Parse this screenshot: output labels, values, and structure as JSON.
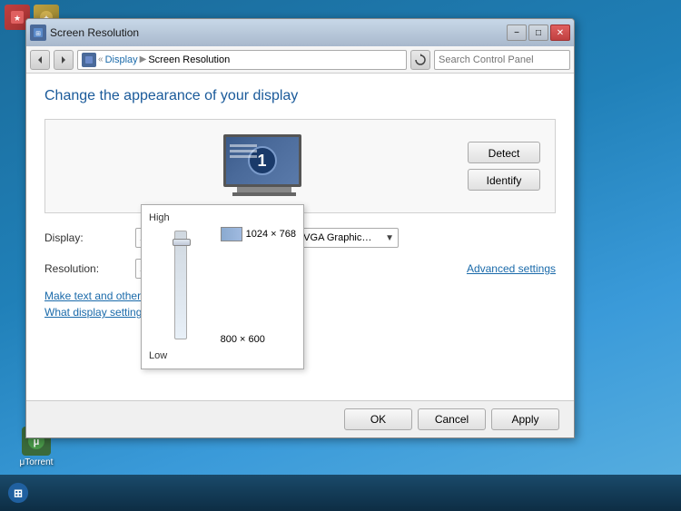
{
  "desktop": {
    "background_color": "#1a6b9a"
  },
  "taskbar_icons": [
    {
      "name": "utorrent",
      "label": "μTorrent",
      "color": "#4a7a4a"
    }
  ],
  "top_left_icons": [
    {
      "name": "icon1",
      "color": "#8a3a3a"
    },
    {
      "name": "icon2",
      "color": "#8a7a3a"
    }
  ],
  "window": {
    "title": "Screen Resolution",
    "titlebar_text": "Screen Resolution",
    "minimize_label": "−",
    "maximize_label": "□",
    "close_label": "✕"
  },
  "address_bar": {
    "back_icon": "◀",
    "forward_icon": "▶",
    "breadcrumb_icon": "⊞",
    "breadcrumb_arrow1": "«",
    "display_link": "Display",
    "separator": "▶",
    "current_page": "Screen Resolution",
    "refresh_icon": "↻",
    "search_placeholder": "Search Control Panel"
  },
  "content": {
    "page_title": "Change the appearance of your display",
    "detect_button": "Detect",
    "identify_button": "Identify",
    "display_label": "Display:",
    "display_value": "1. Generic PnP Monitor on Standard VGA Graphics Adapter",
    "resolution_label": "Resolution:",
    "resolution_value": "1024 × 768",
    "advanced_link": "Advanced settings",
    "help_link1": "Make text and other items larger or smaller",
    "help_link2": "What display settings should I choose?",
    "monitor_number": "1"
  },
  "slider_dropdown": {
    "high_label": "High",
    "resolution_high": "1024 × 768",
    "resolution_low": "800 × 600",
    "low_label": "Low"
  },
  "buttons": {
    "ok": "OK",
    "cancel": "Cancel",
    "apply": "Apply"
  }
}
